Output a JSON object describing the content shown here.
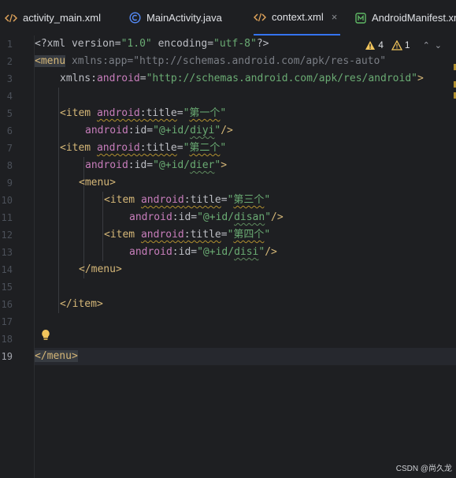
{
  "tabs": [
    {
      "label": "activity_main.xml",
      "icon": "xml-file-icon",
      "active": false
    },
    {
      "label": "MainActivity.java",
      "icon": "java-class-icon",
      "active": false
    },
    {
      "label": "context.xml",
      "icon": "xml-file-icon",
      "active": true,
      "close": "×"
    },
    {
      "label": "AndroidManifest.xml",
      "icon": "manifest-file-icon",
      "active": false
    }
  ],
  "inspections": {
    "warnings": "4",
    "weak_warnings": "1",
    "up_arrow": "⌃",
    "down_arrow": "⌄"
  },
  "gutter": {
    "line_numbers": [
      "1",
      "2",
      "3",
      "4",
      "5",
      "6",
      "7",
      "8",
      "9",
      "10",
      "11",
      "12",
      "13",
      "14",
      "15",
      "16",
      "17",
      "18",
      "19"
    ],
    "current_line": "19"
  },
  "code": {
    "l1": {
      "open": "<?xml ",
      "a1": "version",
      "eq1": "=",
      "v1": "\"1.0\"",
      "sp": " ",
      "a2": "encoding",
      "eq2": "=",
      "v2": "\"utf-8\"",
      "close": "?>"
    },
    "l2": {
      "lt": "<",
      "tag": "menu",
      "rest": " xmlns:app=\"http://schemas.android.com/apk/res-auto\""
    },
    "l3": {
      "ns": "xmlns",
      "colon": ":",
      "attr": "android",
      "eq": "=",
      "val": "\"http://schemas.android.com/apk/res/android\"",
      "gt": ">"
    },
    "l5": {
      "lt": "<",
      "tag": "item",
      "sp": " ",
      "ns": "android",
      "colon": ":",
      "attr": "title",
      "eq": "=",
      "q1": "\"",
      "text": "第一个",
      "q2": "\""
    },
    "l6": {
      "ns": "android",
      "colon": ":",
      "attr": "id",
      "eq": "=",
      "val1": "\"@+id/",
      "val2": "diyi",
      "q": "\"",
      "close": "/>"
    },
    "l7": {
      "lt": "<",
      "tag": "item",
      "sp": " ",
      "ns": "android",
      "colon": ":",
      "attr": "title",
      "eq": "=",
      "q1": "\"",
      "text": "第二个",
      "q2": "\""
    },
    "l8": {
      "ns": "android",
      "colon": ":",
      "attr": "id",
      "eq": "=",
      "val1": "\"@+id/",
      "val2": "dier",
      "q": "\"",
      "close": ">"
    },
    "l9": {
      "lt": "<",
      "tag": "menu",
      "gt": ">"
    },
    "l10": {
      "lt": "<",
      "tag": "item",
      "sp": " ",
      "ns": "android",
      "colon": ":",
      "attr": "title",
      "eq": "=",
      "q1": "\"",
      "text": "第三个",
      "q2": "\""
    },
    "l11": {
      "ns": "android",
      "colon": ":",
      "attr": "id",
      "eq": "=",
      "val1": "\"@+id/",
      "val2": "disan",
      "q": "\"",
      "close": "/>"
    },
    "l12": {
      "lt": "<",
      "tag": "item",
      "sp": " ",
      "ns": "android",
      "colon": ":",
      "attr": "title",
      "eq": "=",
      "q1": "\"",
      "text": "第四个",
      "q2": "\""
    },
    "l13": {
      "ns": "android",
      "colon": ":",
      "attr": "id",
      "eq": "=",
      "val1": "\"@+id/",
      "val2": "disi",
      "q": "\"",
      "close": "/>"
    },
    "l14": {
      "lt": "</",
      "tag": "menu",
      "gt": ">"
    },
    "l16": {
      "lt": "</",
      "tag": "item",
      "gt": ">"
    },
    "l19": {
      "lt": "</",
      "tag": "menu",
      "gt": ">"
    }
  },
  "watermark": "CSDN @尚久龙",
  "colors": {
    "background": "#1e1f22",
    "tag": "#d5b778",
    "namespace": "#c77dbb",
    "string": "#6aab73",
    "warning": "#f2c55c",
    "accent": "#3574f0"
  }
}
